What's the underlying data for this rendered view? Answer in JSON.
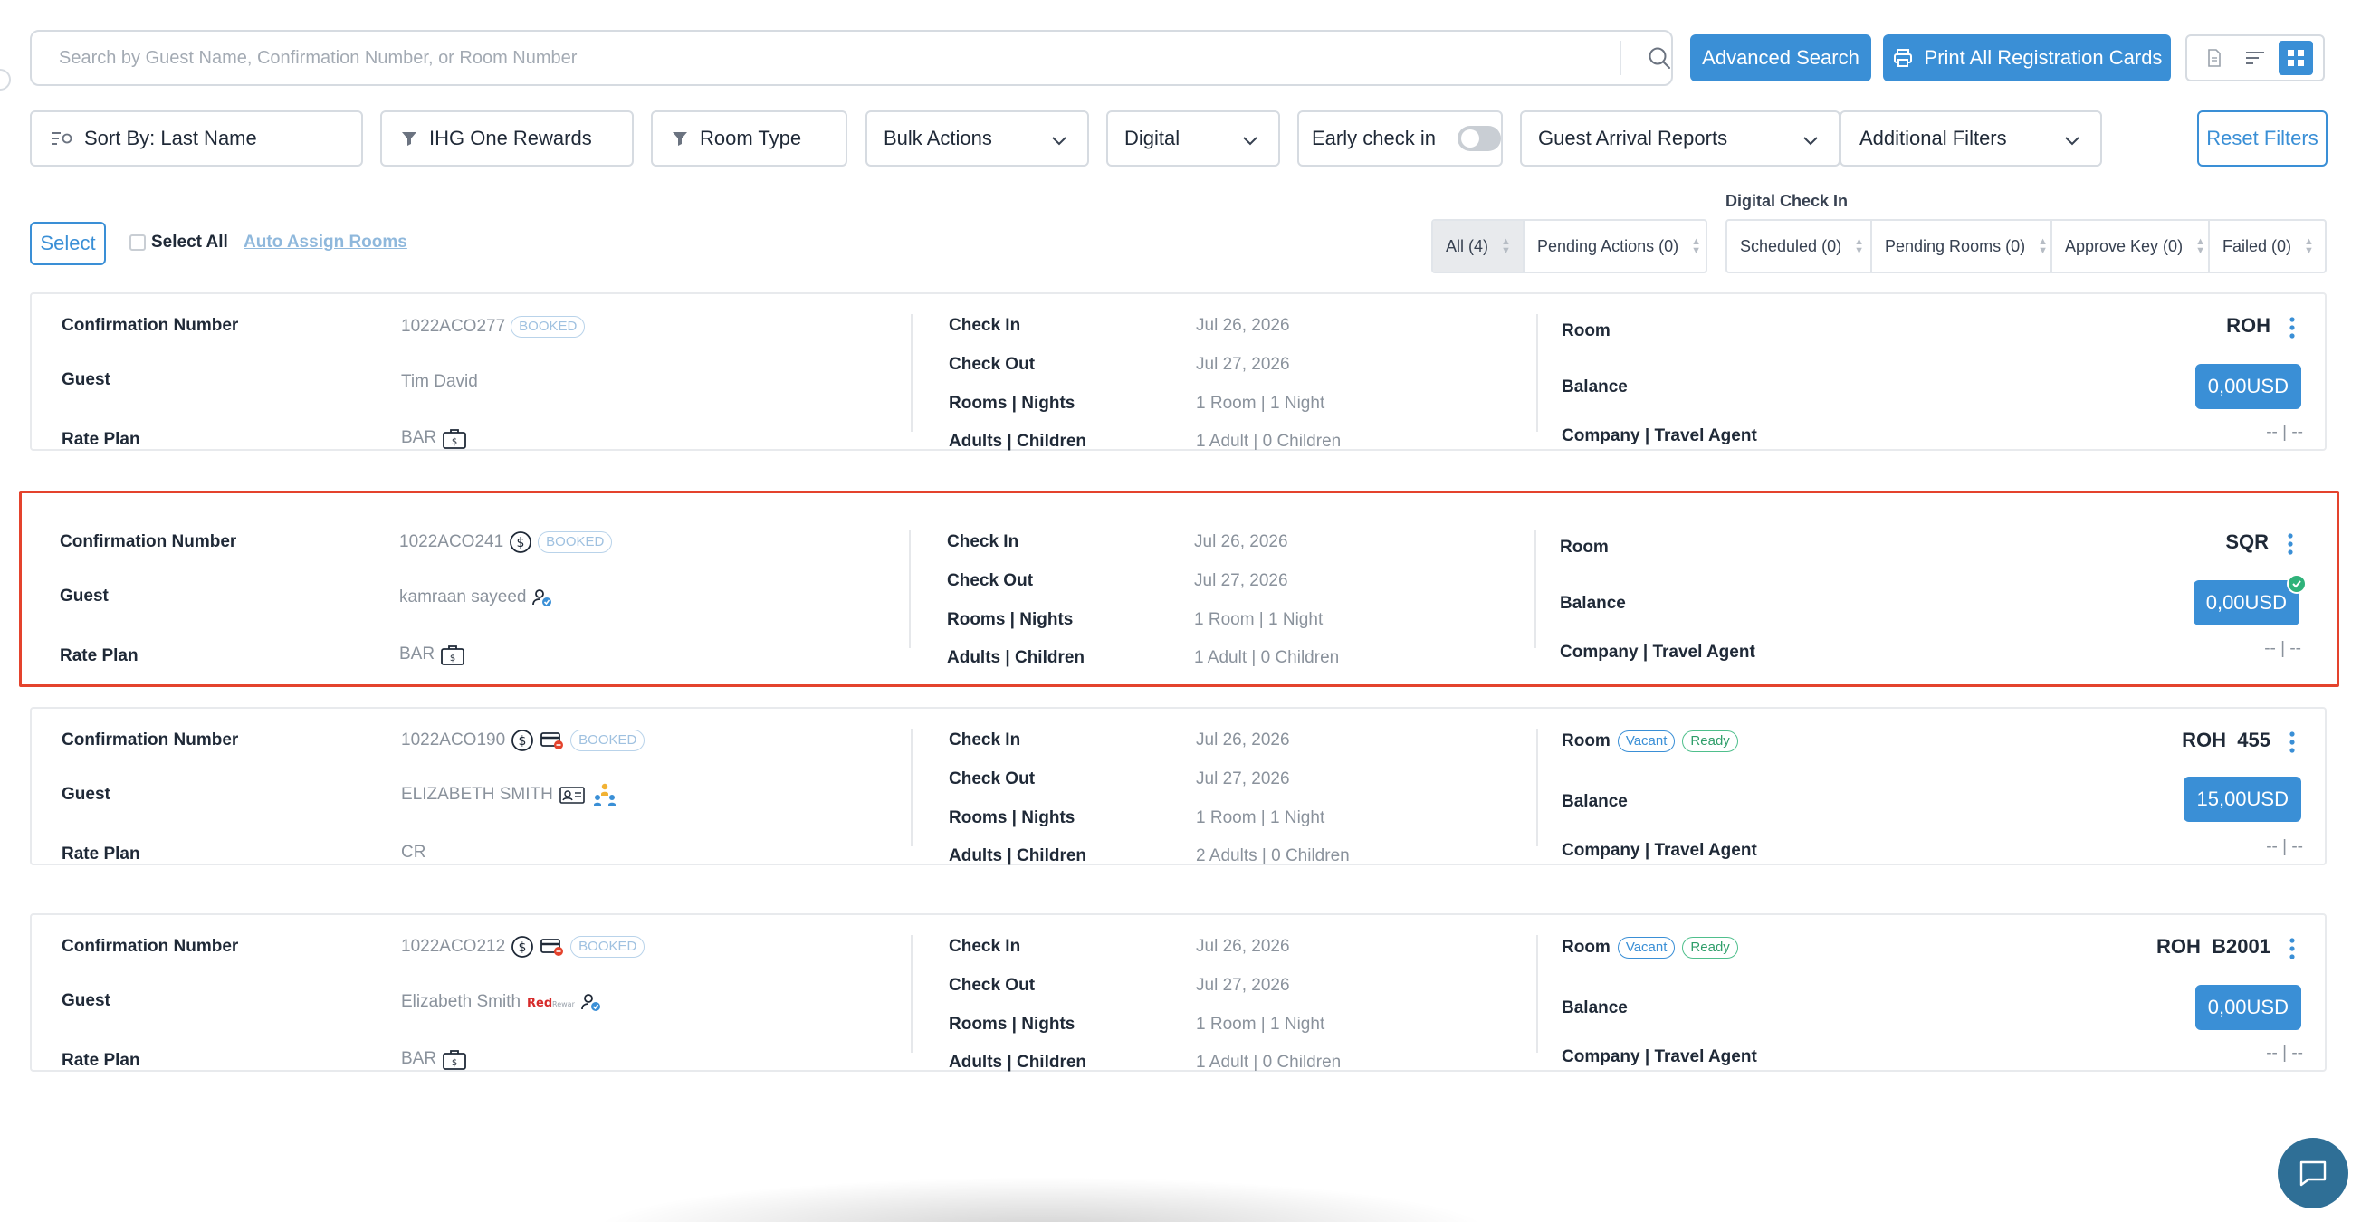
{
  "search": {
    "placeholder": "Search by Guest Name, Confirmation Number, or Room Number",
    "value": ""
  },
  "header": {
    "advanced_search": "Advanced Search",
    "print_all": "Print All Registration Cards"
  },
  "filters": {
    "sort": "Sort By: Last Name",
    "loyalty": "IHG One Rewards",
    "room_type": "Room Type",
    "bulk_actions": "Bulk Actions",
    "digital": "Digital",
    "early_checkin": "Early check in",
    "early_checkin_on": false,
    "arrival_reports": "Guest Arrival Reports",
    "additional": "Additional Filters",
    "reset": "Reset Filters"
  },
  "selection": {
    "select": "Select",
    "select_all": "Select All",
    "auto_assign": "Auto Assign Rooms"
  },
  "status_tabs": [
    {
      "label": "All (4)",
      "active": true
    },
    {
      "label": "Pending Actions (0)"
    }
  ],
  "digital_checkin": {
    "title": "Digital Check In",
    "tabs": [
      {
        "label": "Scheduled (0)"
      },
      {
        "label": "Pending Rooms (0)"
      },
      {
        "label": "Approve Key (0)"
      },
      {
        "label": "Failed (0)"
      }
    ]
  },
  "labels": {
    "confirmation": "Confirmation Number",
    "guest": "Guest",
    "rate_plan": "Rate Plan",
    "check_in": "Check In",
    "check_out": "Check Out",
    "rooms_nights": "Rooms | Nights",
    "adults_children": "Adults | Children",
    "room": "Room",
    "balance": "Balance",
    "company": "Company | Travel Agent"
  },
  "reservations": [
    {
      "confirmation": "1022ACO277",
      "status": "BOOKED",
      "guest": "Tim David",
      "rate_plan": "BAR",
      "check_in": "Jul 26, 2026",
      "check_out": "Jul 27, 2026",
      "rooms_nights": "1 Room | 1 Night",
      "adults_children": "1 Adult | 0 Children",
      "room": "ROH",
      "balance": "0,00USD",
      "company": "-- | --"
    },
    {
      "confirmation": "1022ACO241",
      "status": "BOOKED",
      "guest": "kamraan sayeed",
      "rate_plan": "BAR",
      "check_in": "Jul 26, 2026",
      "check_out": "Jul 27, 2026",
      "rooms_nights": "1 Room | 1 Night",
      "adults_children": "1 Adult | 0 Children",
      "room": "SQR",
      "balance": "0,00USD",
      "company": "-- | --"
    },
    {
      "confirmation": "1022ACO190",
      "status": "BOOKED",
      "guest": "ELIZABETH SMITH",
      "rate_plan": "CR",
      "check_in": "Jul 26, 2026",
      "check_out": "Jul 27, 2026",
      "rooms_nights": "1 Room | 1 Night",
      "adults_children": "2 Adults | 0 Children",
      "room_status": [
        "Vacant",
        "Ready"
      ],
      "room": "ROH  455",
      "balance": "15,00USD",
      "company": "-- | --"
    },
    {
      "confirmation": "1022ACO212",
      "status": "BOOKED",
      "guest": "Elizabeth Smith",
      "rate_plan": "BAR",
      "check_in": "Jul 26, 2026",
      "check_out": "Jul 27, 2026",
      "rooms_nights": "1 Room | 1 Night",
      "adults_children": "1 Adult | 0 Children",
      "room_status": [
        "Vacant",
        "Ready"
      ],
      "room": "ROH  B2001",
      "balance": "0,00USD",
      "company": "-- | --",
      "loyalty_logo": "RedRewards"
    }
  ],
  "icons": {
    "search": "search-icon",
    "print": "printer-icon",
    "view_list": "list-view-icon",
    "view_sort": "sort-view-icon",
    "view_grid": "grid-view-icon",
    "filter": "funnel-icon",
    "sort": "sort-lines-icon",
    "chevron": "chevron-down-icon",
    "dollar": "dollar-circle-icon",
    "card": "credit-card-icon",
    "bag": "briefcase-icon",
    "chat": "chat-bubble-icon"
  },
  "colors": {
    "accent": "#3a8fd6",
    "highlight": "#e4432d",
    "success": "#2fb27a"
  }
}
